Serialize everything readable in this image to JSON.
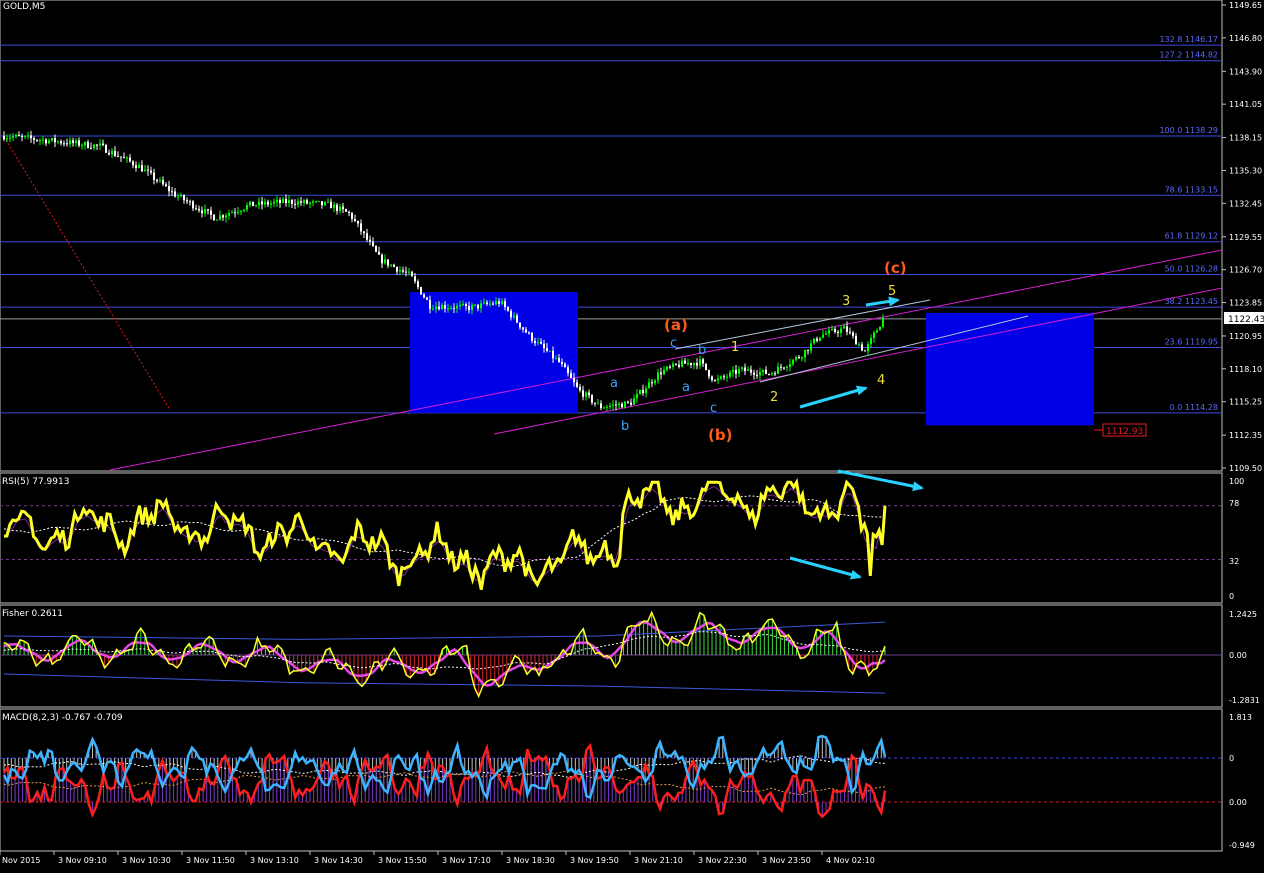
{
  "main": {
    "title": "GOLD,M5",
    "price_ticks": [
      "1149.65",
      "1146.80",
      "1143.90",
      "1141.05",
      "1138.15",
      "1135.30",
      "1132.45",
      "1129.55",
      "1126.70",
      "1123.85",
      "1120.95",
      "1118.10",
      "1115.25",
      "1112.35",
      "1109.50"
    ],
    "current_price": "1122.43",
    "target_price": "1112.93"
  },
  "fibo": [
    {
      "label": "132.8 1146.17",
      "price": 1146.17
    },
    {
      "label": "127.2 1144.82",
      "price": 1144.82
    },
    {
      "label": "100.0 1138.29",
      "price": 1138.29
    },
    {
      "label": "78.6 1133.15",
      "price": 1133.15
    },
    {
      "label": "61.8 1129.12",
      "price": 1129.12
    },
    {
      "label": "50.0 1126.28",
      "price": 1126.28
    },
    {
      "label": "38.2 1123.45",
      "price": 1123.45
    },
    {
      "label": "23.6 1119.95",
      "price": 1119.95
    },
    {
      "label": "0.0 1114.28",
      "price": 1114.28
    }
  ],
  "wave_labels": {
    "a_paren": "(a)",
    "b_paren": "(b)",
    "c_paren": "(c)",
    "a1": "a",
    "b1": "b",
    "c1": "c",
    "a2": "a",
    "b2": "b",
    "c2": "c",
    "n1": "1",
    "n2": "2",
    "n3": "3",
    "n4": "4",
    "n5": "5"
  },
  "rsi": {
    "title": "RSI(5) 77.9913",
    "ticks": [
      "100",
      "78",
      "32",
      "0"
    ]
  },
  "fisher": {
    "title": "Fisher 0.2611",
    "ticks": [
      "1.2425",
      "0.00",
      "-1.2831"
    ]
  },
  "macd": {
    "title": "MACD(8,2,3) -0.767 -0.709",
    "ticks": [
      "1.813",
      "0",
      "0.00",
      "-0.949"
    ]
  },
  "time_axis": [
    "Nov 2015",
    "3 Nov 09:10",
    "3 Nov 10:30",
    "3 Nov 11:50",
    "3 Nov 13:10",
    "3 Nov 14:30",
    "3 Nov 15:50",
    "3 Nov 17:10",
    "3 Nov 18:30",
    "3 Nov 19:50",
    "3 Nov 21:10",
    "3 Nov 22:30",
    "3 Nov 23:50",
    "4 Nov 02:10"
  ],
  "colors": {
    "bull": "#00ff00",
    "bear": "#ffffff",
    "fibo": "#3d4ddb",
    "box": "#0000e6",
    "channel": "#d21ed2",
    "wave_orange": "#ff5a1e",
    "wave_blue": "#3ca0ff",
    "wave_yellow": "#f0dc3c",
    "arrow": "#28d2ff",
    "rsi": "#ffff28",
    "macd_red": "#ff1e1e",
    "macd_blue": "#3cb4ff"
  },
  "chart_data": {
    "type": "line",
    "title": "GOLD,M5",
    "xlabel": "",
    "ylabel": "",
    "ylim": [
      1109.5,
      1149.65
    ],
    "x": [
      "Nov 2015",
      "3 Nov 09:10",
      "3 Nov 10:30",
      "3 Nov 11:50",
      "3 Nov 13:10",
      "3 Nov 14:30",
      "3 Nov 15:50",
      "3 Nov 17:10",
      "3 Nov 18:30",
      "3 Nov 19:50",
      "3 Nov 21:10",
      "3 Nov 22:30",
      "3 Nov 23:50",
      "4 Nov 02:10"
    ],
    "series": [
      {
        "values": [
          1138.3,
          1137.5,
          1135.8,
          1132.9,
          1132.5,
          1132.4,
          1126.5,
          1123.5,
          1122.8,
          1117.5,
          1114.6,
          1117.4,
          1117.1,
          1118.6,
          1120.8,
          1122.8
        ]
      }
    ],
    "grid": false
  }
}
